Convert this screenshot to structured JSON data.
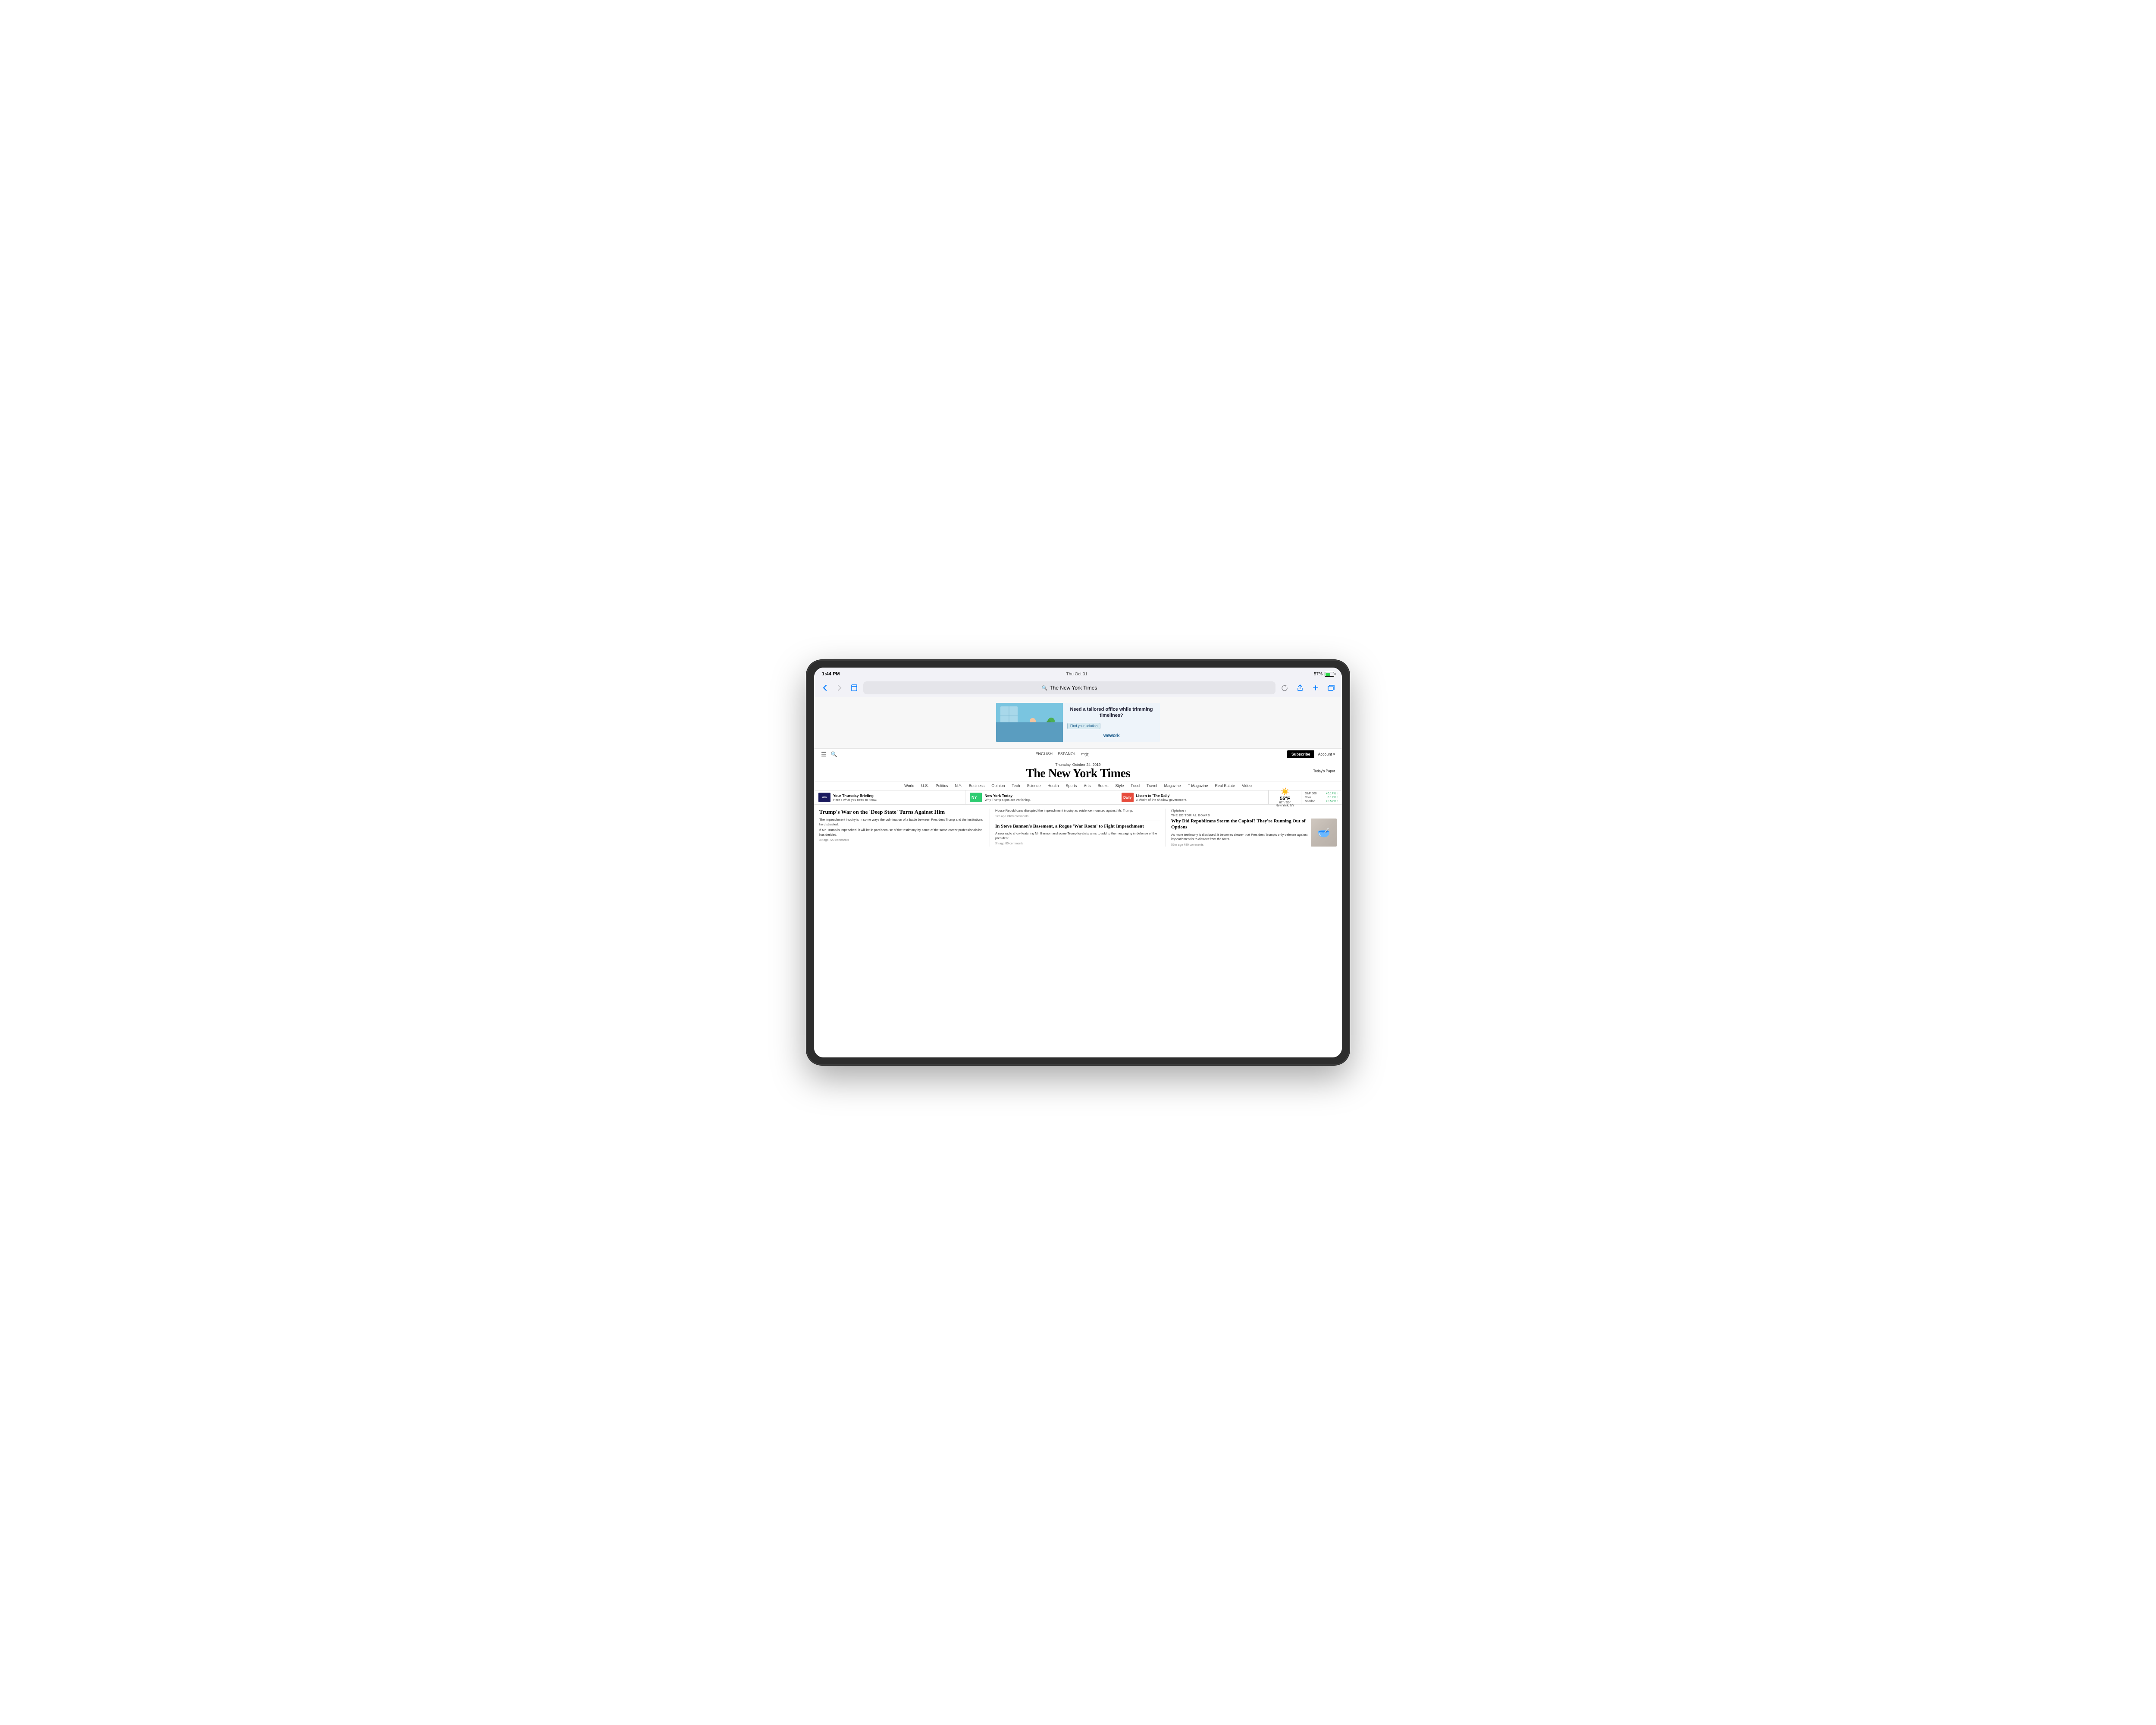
{
  "device": {
    "type": "iPad Pro",
    "status_bar": {
      "time": "1:44 PM",
      "day": "Thu Oct 31",
      "battery_percent": "57%"
    }
  },
  "safari": {
    "back_button": "‹",
    "forward_button": "›",
    "bookmark_icon": "□",
    "address_bar_text": "The New York Times",
    "reload_label": "↻",
    "share_label": "⬆",
    "new_tab_label": "+",
    "tabs_label": "⊞"
  },
  "ad": {
    "headline": "Need a tailored office while trimming timelines?",
    "cta": "Find your solution",
    "brand": "wework"
  },
  "nyt_header": {
    "languages": [
      "ENGLISH",
      "ESPAÑOL",
      "中文"
    ],
    "subscribe_label": "Subscribe",
    "account_label": "Account ▾"
  },
  "nyt_masthead": {
    "date": "Thursday, October 24, 2019",
    "logo": "The New York Times",
    "today_paper": "Today's Paper"
  },
  "nav": {
    "items": [
      "World",
      "U.S.",
      "Politics",
      "N.Y.",
      "Business",
      "Opinion",
      "Tech",
      "Science",
      "Health",
      "Sports",
      "Arts",
      "Books",
      "Style",
      "Food",
      "Travel",
      "Magazine",
      "T Magazine",
      "Real Estate",
      "Video"
    ]
  },
  "briefings": [
    {
      "thumb_label": "am",
      "thumb_type": "am",
      "title": "Your Thursday Briefing",
      "desc": "Here's what you need to know."
    },
    {
      "thumb_label": "NY",
      "thumb_type": "ny",
      "title": "New York Today",
      "desc": "Why Trump signs are vanishing."
    },
    {
      "thumb_label": "Daily",
      "thumb_type": "daily",
      "title": "Listen to 'The Daily'",
      "desc": "A victim of the shadow government."
    }
  ],
  "stocks": {
    "items": [
      {
        "name": "S&P 500",
        "value": "",
        "change": "+0.14% ↑"
      },
      {
        "name": "Dow",
        "value": "",
        "change": "0.12% ↑"
      },
      {
        "name": "Nasdaq",
        "value": "",
        "change": "+0.57% ↑"
      }
    ]
  },
  "weather": {
    "temp": "55°F",
    "location": "New York, NY",
    "hi": "67°",
    "lo": "50°"
  },
  "articles": [
    {
      "col": 1,
      "title": "Trump's War on the 'Deep State' Turns Against Him",
      "body": [
        "The impeachment inquiry is in some ways the culmination of a battle between President Trump and the institutions he distrusted.",
        "If Mr. Trump is impeached, it will be in part because of the testimony by some of the same career professionals he has derided."
      ],
      "meta": "39 ago  729 comments"
    },
    {
      "col": 2,
      "title": "House Republicans disrupted the impeachment inquiry as evidence mounted against Mr. Trump.",
      "subtitle": "In Steve Bannon's Basement, a Rogue 'War Room' to Fight Impeachment",
      "body": "A new radio show featuring Mr. Bannon and some Trump loyalists aims to add to the messaging in defense of the president.",
      "meta_top": "12h ago  2460 comments",
      "meta_bottom": "3h ago  80 comments"
    },
    {
      "col": 3,
      "opinion_label": "Opinion ›",
      "opinion_board": "The Editorial Board",
      "title": "Why Did Republicans Storm the Capitol? They're Running Out of Options",
      "body": "As more testimony is disclosed, it becomes clearer that President Trump's only defense against impeachment is to distract from the facts.",
      "meta": "55m ago  480 comments",
      "has_photo": true
    }
  ]
}
